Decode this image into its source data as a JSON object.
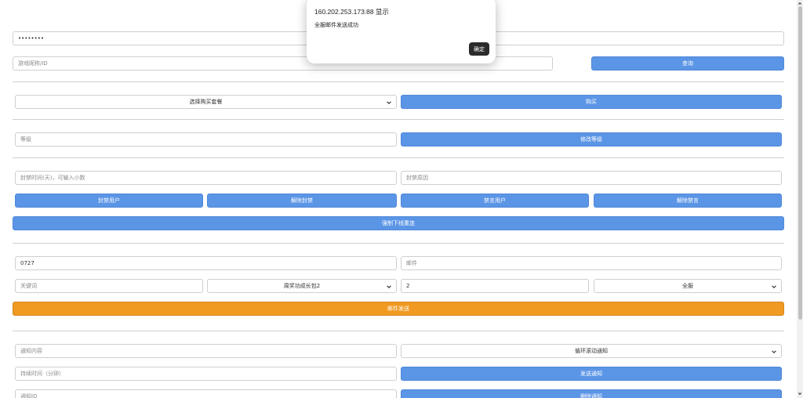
{
  "top": {
    "password_value": "••••••••",
    "player_placeholder": "游戏昵称/ID",
    "query_label": "查询"
  },
  "purchase": {
    "package_select": "选择购买套餐",
    "buy_label": "购买"
  },
  "level": {
    "level_placeholder": "等级",
    "modify_label": "修改等级"
  },
  "ban": {
    "time_placeholder": "封禁时间(天)，可输入小数",
    "reason_placeholder": "封禁原因",
    "ban_user_label": "封禁用户",
    "unban_label": "解除封禁",
    "mute_label": "禁言用户",
    "unmute_label": "解除禁言",
    "force_relogin_label": "强制下线重连"
  },
  "mail": {
    "code_value": "0727",
    "mail_placeholder": "邮件",
    "keyword_placeholder": "关键词",
    "item_select": "周奖功成长包2",
    "count_value": "2",
    "scope_select": "全服",
    "send_label": "邮件发送"
  },
  "notice": {
    "content_placeholder": "通知内容",
    "type_select": "循环滚动通知",
    "wait_placeholder": "持续时间（分钟）",
    "send_label": "发送通知",
    "notice_id_placeholder": "通知ID",
    "delete_label": "删除通知"
  },
  "dialog": {
    "title": "160.202.253.173:88 显示",
    "message": "全服邮件发送成功",
    "ok_label": "确定"
  },
  "colors": {
    "primary": "#5b95e6",
    "accent": "#f09a22"
  }
}
